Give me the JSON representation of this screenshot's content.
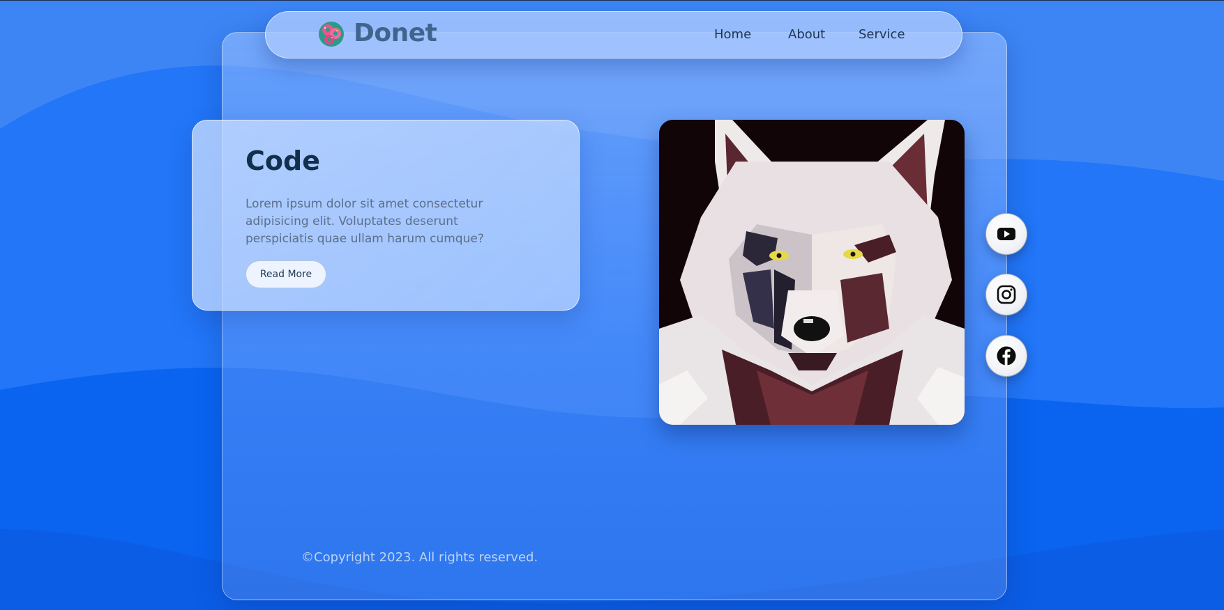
{
  "brand": {
    "name": "Donet",
    "logo_icon": "donut-logo-icon"
  },
  "nav": {
    "items": [
      {
        "label": "Home"
      },
      {
        "label": "About"
      },
      {
        "label": "Service"
      }
    ]
  },
  "hero": {
    "title": "Code",
    "description": "Lorem ipsum dolor sit amet consectetur adipisicing elit. Voluptates deserunt perspiciatis quae ullam harum cumque?",
    "button_label": "Read More"
  },
  "image": {
    "subject": "wolf-portrait-image"
  },
  "social": [
    {
      "icon": "youtube-icon"
    },
    {
      "icon": "instagram-icon"
    },
    {
      "icon": "facebook-icon"
    }
  ],
  "footer": {
    "copyright": "©Copyright 2023. All rights reserved."
  },
  "colors": {
    "background": "#2f7cf0",
    "brand_text": "#41648f",
    "heading": "#12304b",
    "body_text": "#5a6f8a"
  }
}
